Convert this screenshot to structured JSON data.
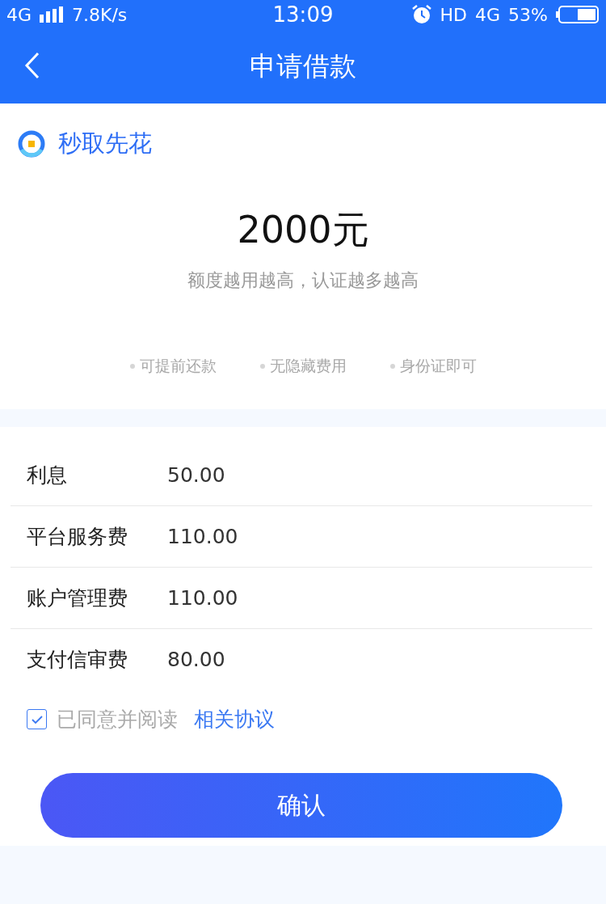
{
  "status_bar": {
    "network": "4G",
    "speed": "7.8K/s",
    "time": "13:09",
    "hd": "HD",
    "data_network": "4G",
    "battery": "53%"
  },
  "header": {
    "title": "申请借款"
  },
  "lender": {
    "name": "秒取先花"
  },
  "amount": {
    "value": "2000元",
    "hint": "额度越用越高，认证越多越高"
  },
  "features": [
    "可提前还款",
    "无隐藏费用",
    "身份证即可"
  ],
  "fees": [
    {
      "label": "利息",
      "value": "50.00"
    },
    {
      "label": "平台服务费",
      "value": "110.00"
    },
    {
      "label": "账户管理费",
      "value": "110.00"
    },
    {
      "label": "支付信审费",
      "value": "80.00"
    }
  ],
  "agreement": {
    "checked": true,
    "text": "已同意并阅读",
    "link": "相关协议"
  },
  "confirm_button": "确认"
}
